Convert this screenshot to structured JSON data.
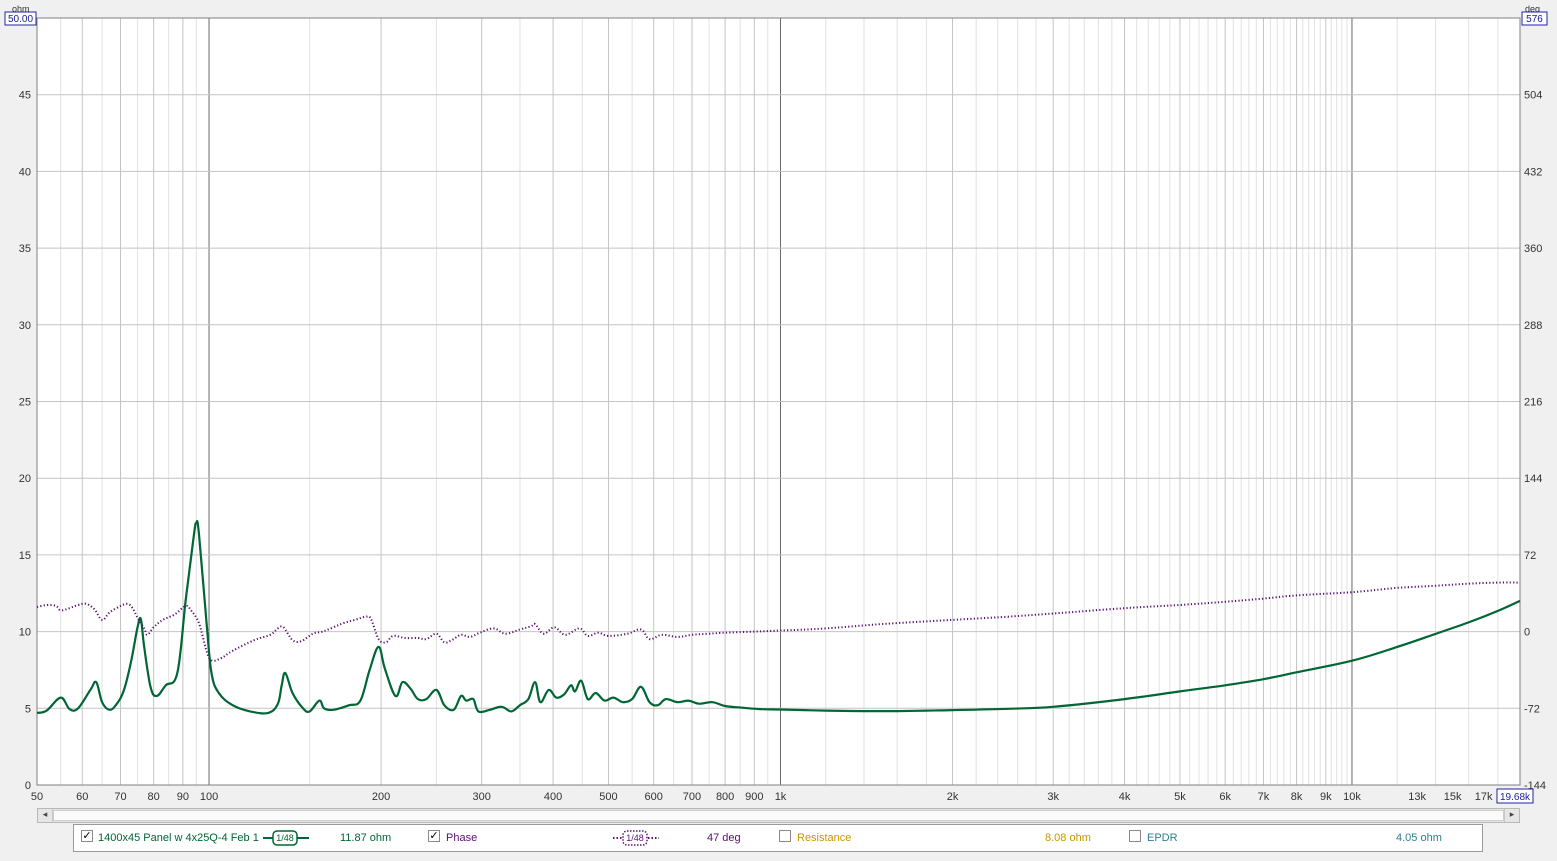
{
  "chart_data": {
    "type": "line",
    "x_scale": "log",
    "x_range": [
      50,
      19680
    ],
    "y_left": {
      "unit": "ohm",
      "range": [
        0,
        50
      ],
      "ticks": [
        "0",
        "5",
        "10",
        "15",
        "20",
        "25",
        "30",
        "35",
        "40",
        "45"
      ],
      "top_value": "50.00"
    },
    "y_right": {
      "unit": "deg",
      "range": [
        -144,
        576
      ],
      "ticks": [
        "-144",
        "-72",
        "0",
        "72",
        "144",
        "216",
        "288",
        "360",
        "432",
        "504"
      ],
      "top_value": "576"
    },
    "x_tick_labels": [
      {
        "v": 50,
        "t": "50"
      },
      {
        "v": 60,
        "t": "60"
      },
      {
        "v": 70,
        "t": "70"
      },
      {
        "v": 80,
        "t": "80"
      },
      {
        "v": 90,
        "t": "90"
      },
      {
        "v": 100,
        "t": "100"
      },
      {
        "v": 200,
        "t": "200"
      },
      {
        "v": 300,
        "t": "300"
      },
      {
        "v": 400,
        "t": "400"
      },
      {
        "v": 500,
        "t": "500"
      },
      {
        "v": 600,
        "t": "600"
      },
      {
        "v": 700,
        "t": "700"
      },
      {
        "v": 800,
        "t": "800"
      },
      {
        "v": 900,
        "t": "900"
      },
      {
        "v": 1000,
        "t": "1k"
      },
      {
        "v": 2000,
        "t": "2k"
      },
      {
        "v": 3000,
        "t": "3k"
      },
      {
        "v": 4000,
        "t": "4k"
      },
      {
        "v": 5000,
        "t": "5k"
      },
      {
        "v": 6000,
        "t": "6k"
      },
      {
        "v": 7000,
        "t": "7k"
      },
      {
        "v": 8000,
        "t": "8k"
      },
      {
        "v": 9000,
        "t": "9k"
      },
      {
        "v": 10000,
        "t": "10k"
      },
      {
        "v": 13000,
        "t": "13k"
      },
      {
        "v": 15000,
        "t": "15k"
      },
      {
        "v": 17000,
        "t": "17k"
      }
    ],
    "x_end_label": "19.68k",
    "series": [
      {
        "name": "1400x45 Panel w 4x25Q-4 Feb 1",
        "axis": "left",
        "color": "#006633",
        "style": "solid",
        "points": [
          [
            50,
            4.7
          ],
          [
            52,
            4.85
          ],
          [
            55,
            5.7
          ],
          [
            57,
            4.95
          ],
          [
            59,
            5.0
          ],
          [
            62,
            6.2
          ],
          [
            63.5,
            6.7
          ],
          [
            65,
            5.4
          ],
          [
            67,
            4.9
          ],
          [
            69,
            5.3
          ],
          [
            71,
            6.2
          ],
          [
            73,
            8.0
          ],
          [
            75,
            10.3
          ],
          [
            76,
            10.8
          ],
          [
            77,
            9.0
          ],
          [
            79,
            6.4
          ],
          [
            81,
            5.8
          ],
          [
            84,
            6.5
          ],
          [
            88,
            7.3
          ],
          [
            91,
            12.0
          ],
          [
            94,
            16.2
          ],
          [
            95,
            17.1
          ],
          [
            96,
            16.4
          ],
          [
            99,
            10.6
          ],
          [
            101,
            7.3
          ],
          [
            104,
            6.0
          ],
          [
            110,
            5.2
          ],
          [
            118,
            4.8
          ],
          [
            127,
            4.7
          ],
          [
            132,
            5.3
          ],
          [
            134,
            6.5
          ],
          [
            136,
            7.3
          ],
          [
            140,
            6.0
          ],
          [
            146,
            5.0
          ],
          [
            150,
            4.8
          ],
          [
            156,
            5.5
          ],
          [
            159,
            5.0
          ],
          [
            165,
            4.9
          ],
          [
            176,
            5.2
          ],
          [
            184,
            5.5
          ],
          [
            191,
            7.5
          ],
          [
            198,
            9.0
          ],
          [
            203,
            7.6
          ],
          [
            212,
            5.8
          ],
          [
            218,
            6.7
          ],
          [
            225,
            6.3
          ],
          [
            232,
            5.6
          ],
          [
            240,
            5.6
          ],
          [
            250,
            6.2
          ],
          [
            258,
            5.2
          ],
          [
            268,
            4.9
          ],
          [
            276,
            5.8
          ],
          [
            282,
            5.5
          ],
          [
            290,
            5.6
          ],
          [
            296,
            4.8
          ],
          [
            310,
            4.9
          ],
          [
            325,
            5.1
          ],
          [
            338,
            4.8
          ],
          [
            350,
            5.2
          ],
          [
            362,
            5.6
          ],
          [
            372,
            6.7
          ],
          [
            380,
            5.4
          ],
          [
            393,
            6.2
          ],
          [
            405,
            5.7
          ],
          [
            418,
            5.9
          ],
          [
            430,
            6.5
          ],
          [
            437,
            6.1
          ],
          [
            448,
            6.8
          ],
          [
            460,
            5.6
          ],
          [
            475,
            6.0
          ],
          [
            492,
            5.5
          ],
          [
            510,
            5.7
          ],
          [
            530,
            5.4
          ],
          [
            550,
            5.6
          ],
          [
            570,
            6.4
          ],
          [
            590,
            5.4
          ],
          [
            610,
            5.2
          ],
          [
            630,
            5.6
          ],
          [
            660,
            5.4
          ],
          [
            690,
            5.5
          ],
          [
            720,
            5.3
          ],
          [
            760,
            5.4
          ],
          [
            800,
            5.15
          ],
          [
            850,
            5.05
          ],
          [
            920,
            4.95
          ],
          [
            1000,
            4.92
          ],
          [
            1100,
            4.88
          ],
          [
            1200,
            4.85
          ],
          [
            1400,
            4.82
          ],
          [
            1600,
            4.82
          ],
          [
            1800,
            4.85
          ],
          [
            2000,
            4.88
          ],
          [
            2500,
            4.97
          ],
          [
            3000,
            5.1
          ],
          [
            4000,
            5.6
          ],
          [
            5000,
            6.1
          ],
          [
            6000,
            6.5
          ],
          [
            7000,
            6.9
          ],
          [
            8000,
            7.35
          ],
          [
            10000,
            8.1
          ],
          [
            12000,
            9.0
          ],
          [
            14000,
            9.85
          ],
          [
            16000,
            10.6
          ],
          [
            18000,
            11.35
          ],
          [
            19680,
            12.0
          ]
        ]
      },
      {
        "name": "Phase",
        "axis": "right",
        "color": "#5a1070",
        "style": "dotted",
        "points": [
          [
            50,
            23
          ],
          [
            52,
            25
          ],
          [
            54,
            24
          ],
          [
            55,
            20
          ],
          [
            57,
            22
          ],
          [
            59,
            25
          ],
          [
            61,
            26
          ],
          [
            63,
            21
          ],
          [
            65,
            11
          ],
          [
            67,
            18
          ],
          [
            70,
            24
          ],
          [
            72,
            26
          ],
          [
            73.5,
            22
          ],
          [
            75,
            13
          ],
          [
            77,
            3
          ],
          [
            78,
            -3
          ],
          [
            80,
            4
          ],
          [
            83,
            11
          ],
          [
            87,
            16
          ],
          [
            91,
            24
          ],
          [
            93,
            20
          ],
          [
            96,
            8
          ],
          [
            99,
            -18
          ],
          [
            101,
            -27
          ],
          [
            105,
            -25
          ],
          [
            110,
            -18
          ],
          [
            120,
            -8
          ],
          [
            128,
            -3
          ],
          [
            132,
            3
          ],
          [
            135,
            4
          ],
          [
            140,
            -8
          ],
          [
            145,
            -9
          ],
          [
            152,
            -2
          ],
          [
            158,
            0
          ],
          [
            165,
            4
          ],
          [
            172,
            8
          ],
          [
            180,
            11
          ],
          [
            188,
            14
          ],
          [
            192,
            12
          ],
          [
            198,
            -7
          ],
          [
            204,
            -10
          ],
          [
            210,
            -4
          ],
          [
            220,
            -6
          ],
          [
            232,
            -6
          ],
          [
            240,
            -7
          ],
          [
            250,
            -2
          ],
          [
            258,
            -10
          ],
          [
            266,
            -8
          ],
          [
            276,
            -3
          ],
          [
            286,
            -5
          ],
          [
            298,
            -1
          ],
          [
            315,
            3
          ],
          [
            330,
            -2
          ],
          [
            350,
            2
          ],
          [
            366,
            5
          ],
          [
            372,
            7
          ],
          [
            385,
            -2
          ],
          [
            402,
            4
          ],
          [
            420,
            -3
          ],
          [
            445,
            3
          ],
          [
            460,
            -4
          ],
          [
            480,
            -1
          ],
          [
            500,
            -4
          ],
          [
            540,
            -2
          ],
          [
            570,
            2
          ],
          [
            590,
            -7
          ],
          [
            620,
            -3
          ],
          [
            660,
            -5
          ],
          [
            700,
            -3
          ],
          [
            750,
            -2
          ],
          [
            800,
            -1
          ],
          [
            900,
            0
          ],
          [
            1000,
            1
          ],
          [
            1200,
            3
          ],
          [
            1500,
            7
          ],
          [
            2000,
            11
          ],
          [
            2500,
            14
          ],
          [
            3000,
            17
          ],
          [
            4000,
            22
          ],
          [
            5000,
            25
          ],
          [
            6000,
            28
          ],
          [
            7000,
            31
          ],
          [
            8000,
            34
          ],
          [
            10000,
            37
          ],
          [
            12000,
            41
          ],
          [
            14000,
            43
          ],
          [
            16000,
            45
          ],
          [
            18000,
            46
          ],
          [
            19680,
            46
          ]
        ]
      }
    ],
    "grid": true
  },
  "legend": {
    "main": {
      "checked": "✓",
      "label": "1400x45 Panel w 4x25Q-4 Feb 1",
      "badge": "1/48",
      "value": "11.87 ohm"
    },
    "phase": {
      "checked": "✓",
      "label": "Phase",
      "badge": "1/48",
      "value": "47 deg"
    },
    "resistance": {
      "checked": "",
      "label": "Resistance",
      "value": "8.08 ohm",
      "color": "#c89600"
    },
    "epdr": {
      "checked": "",
      "label": "EPDR",
      "value": "4.05 ohm",
      "color": "#2e7f8a"
    }
  },
  "scroll": {
    "left_arrow": "◂",
    "right_arrow": "▸"
  }
}
